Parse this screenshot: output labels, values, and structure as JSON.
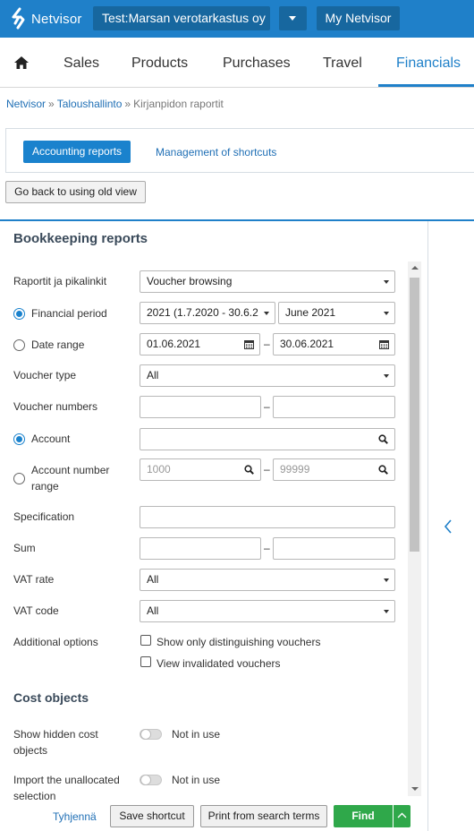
{
  "header": {
    "logo_text": "Netvisor",
    "company": "Test:Marsan verotarkastus oy",
    "my_netvisor": "My Netvisor",
    "brand_color": "#1f80c9"
  },
  "nav": {
    "items": [
      "Sales",
      "Products",
      "Purchases",
      "Travel",
      "Financials"
    ],
    "active": "Financials"
  },
  "breadcrumb": {
    "items": [
      "Netvisor",
      "Taloushallinto",
      "Kirjanpidon raportit"
    ],
    "separator": "»"
  },
  "tabs": {
    "active_label": "Accounting reports",
    "other_label": "Management of shortcuts"
  },
  "old_view_button": "Go back to using old view",
  "bookkeeping": {
    "title": "Bookkeeping reports",
    "report_label": "Raportit ja pikalinkit",
    "report_value": "Voucher browsing",
    "financial_period_label": "Financial period",
    "financial_period_value": "2021 (1.7.2020 - 30.6.2",
    "month_value": "June 2021",
    "date_range_label": "Date range",
    "date_from": "01.06.2021",
    "date_to": "30.06.2021",
    "voucher_type_label": "Voucher type",
    "voucher_type_value": "All",
    "voucher_numbers_label": "Voucher numbers",
    "account_label": "Account",
    "account_number_range_label_1": "Account number",
    "account_number_range_label_2": "range",
    "account_from_placeholder": "1000",
    "account_to_placeholder": "99999",
    "specification_label": "Specification",
    "sum_label": "Sum",
    "vat_rate_label": "VAT rate",
    "vat_rate_value": "All",
    "vat_code_label": "VAT code",
    "vat_code_value": "All",
    "additional_options_label": "Additional options",
    "option_distinguishing": "Show only distinguishing vouchers",
    "option_invalidated": "View invalidated vouchers",
    "dash": "–"
  },
  "cost_objects": {
    "title": "Cost objects",
    "hidden_label_1": "Show hidden cost",
    "hidden_label_2": "objects",
    "hidden_state": "Not in use",
    "unallocated_label_1": "Import the unallocated",
    "unallocated_label_2": "selection",
    "unallocated_state": "Not in use"
  },
  "footer": {
    "clear_link": "Tyhjennä",
    "save_shortcut": "Save shortcut",
    "print": "Print from search terms",
    "find": "Find",
    "find_color": "#2fa84a"
  },
  "icons": [
    "netvisor-logo-icon",
    "chevron-down-icon",
    "home-icon",
    "calendar-icon",
    "search-icon",
    "chevron-left-icon",
    "chevron-up-icon"
  ]
}
